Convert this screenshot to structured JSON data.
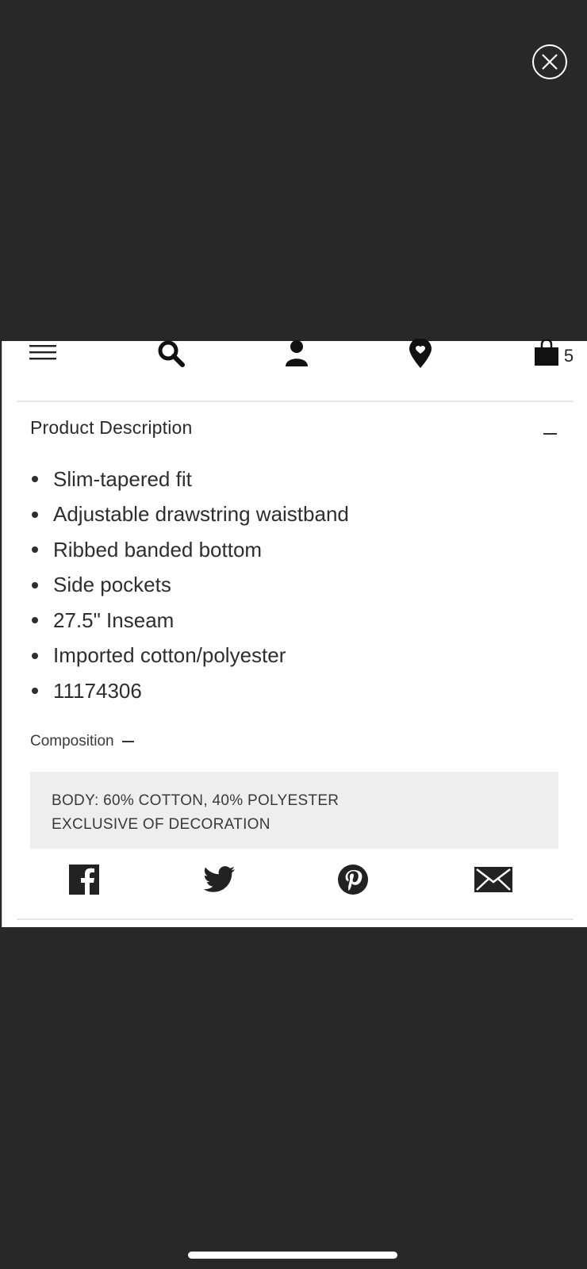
{
  "modal": {
    "close_icon": "close-icon"
  },
  "navbar": {
    "icons": [
      "menu-icon",
      "search-icon",
      "account-icon",
      "location-icon",
      "bag-icon"
    ],
    "bag_count": "5"
  },
  "product_description": {
    "title": "Product Description",
    "toggle_icon": "minus-icon",
    "bullets": [
      "Slim-tapered fit",
      "Adjustable drawstring waistband",
      "Ribbed banded bottom",
      "Side pockets",
      "27.5\" Inseam",
      "Imported cotton/polyester",
      "11174306"
    ]
  },
  "composition": {
    "label": "Composition",
    "lines": [
      "BODY: 60% COTTON, 40% POLYESTER",
      "EXCLUSIVE OF DECORATION"
    ]
  },
  "share": {
    "icons": [
      "facebook-icon",
      "twitter-icon",
      "pinterest-icon",
      "email-icon"
    ]
  },
  "colors": {
    "backdrop": "#282828",
    "card": "#ffffff",
    "text": "#2e2e2e",
    "composition_bg": "#eeeeee"
  }
}
